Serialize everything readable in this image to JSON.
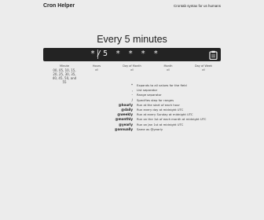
{
  "header": {
    "logo": "Cron Helper",
    "tagline": "Crontab syntax for us humans"
  },
  "headline": "Every 5 minutes",
  "expression": {
    "value": "*/5 * * * *",
    "copy_icon": "clipboard-icon"
  },
  "fields": [
    {
      "name": "Minute",
      "value": "00, 05, 10, 15, 20, 25, 30, 35, 40, 45, 50, and 55"
    },
    {
      "name": "Hours",
      "value": "all"
    },
    {
      "name": "Day of Month",
      "value": "all"
    },
    {
      "name": "Month",
      "value": "all"
    },
    {
      "name": "Day of Week",
      "value": "all"
    }
  ],
  "legend": [
    {
      "key": "*",
      "desc": "Expands to all values for the field"
    },
    {
      "key": ",",
      "desc": "List separator"
    },
    {
      "key": "-",
      "desc": "Range separator"
    },
    {
      "key": "/",
      "desc": "Specifies step for ranges"
    },
    {
      "key": "@hourly",
      "desc": "Run at the start of each hour"
    },
    {
      "key": "@daily",
      "desc": "Run every day at midnight UTC"
    },
    {
      "key": "@weekly",
      "desc": "Run at every Sunday at midnight UTC"
    },
    {
      "key": "@monthly",
      "desc": "Run on the 1st of each month at midnight UTC"
    },
    {
      "key": "@yearly",
      "desc": "Run on Jan 1st at midnight UTC"
    },
    {
      "key": "@annually",
      "desc": "Same as @yearly"
    }
  ]
}
